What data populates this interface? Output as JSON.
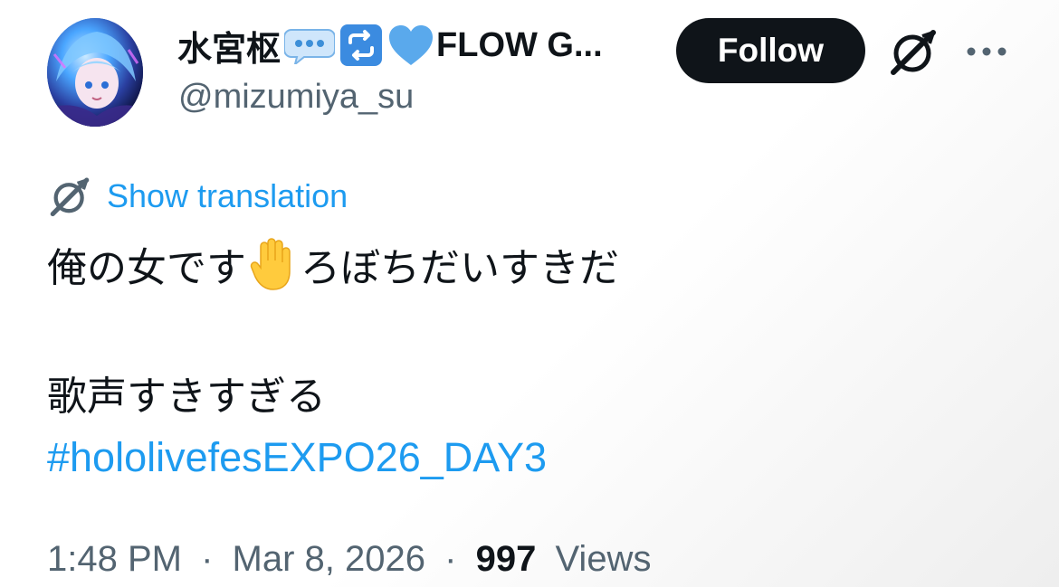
{
  "author": {
    "display_name": "水宮枢",
    "display_name_suffix": "FLOW G...",
    "handle": "@mizumiya_su",
    "avatar_icon": "avatar-image",
    "name_emojis": [
      "speech-bubble-icon",
      "repeat-icon",
      "blue-heart-icon"
    ]
  },
  "actions": {
    "follow_label": "Follow",
    "grok_icon": "grok-icon",
    "more_icon": "more-icon"
  },
  "translation": {
    "label": "Show translation"
  },
  "tweet": {
    "line1_part1": "俺の女です",
    "line1_emoji": "raised-hand-icon",
    "line1_part2": " ろぼちだいすきだ",
    "line2": "歌声すきすぎる",
    "hashtag": "#hololivefesEXPO26_DAY3"
  },
  "meta": {
    "time": "1:48 PM",
    "separator": "·",
    "date": "Mar 8, 2026",
    "views_count": "997",
    "views_label": "Views"
  },
  "colors": {
    "accent": "#1d9bf0",
    "text_primary": "#0f1419",
    "text_secondary": "#536471",
    "follow_bg": "#0f1419",
    "follow_text": "#ffffff"
  }
}
